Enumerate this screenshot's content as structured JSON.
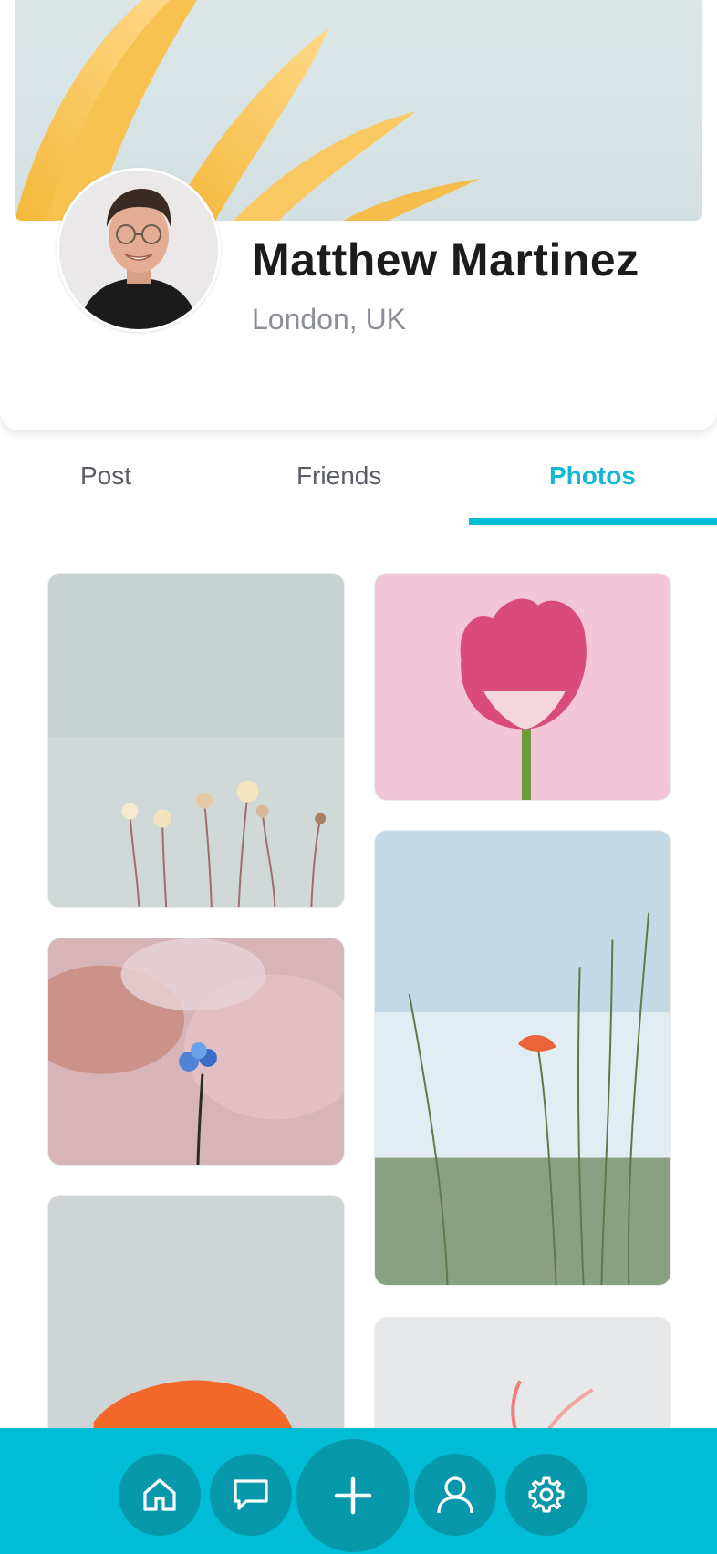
{
  "profile": {
    "name": "Matthew Martinez",
    "location": "London, UK"
  },
  "tabs": [
    {
      "label": "Post",
      "active": false
    },
    {
      "label": "Friends",
      "active": false
    },
    {
      "label": "Photos",
      "active": true
    }
  ],
  "photos": [
    {
      "subject": "wildflowers against grey sky"
    },
    {
      "subject": "pink tulip"
    },
    {
      "subject": "blue forget-me-not on pink bokeh"
    },
    {
      "subject": "orange poppy in meadow"
    },
    {
      "subject": "orange poppy"
    },
    {
      "subject": "pink flower"
    }
  ],
  "bottom_nav": [
    {
      "icon": "home-icon"
    },
    {
      "icon": "chat-icon"
    },
    {
      "icon": "plus-icon"
    },
    {
      "icon": "user-icon"
    },
    {
      "icon": "gear-icon"
    }
  ],
  "colors": {
    "accent": "#00bcd4",
    "nav_button": "#0898ab",
    "active_tab_text": "#13b8d3"
  }
}
